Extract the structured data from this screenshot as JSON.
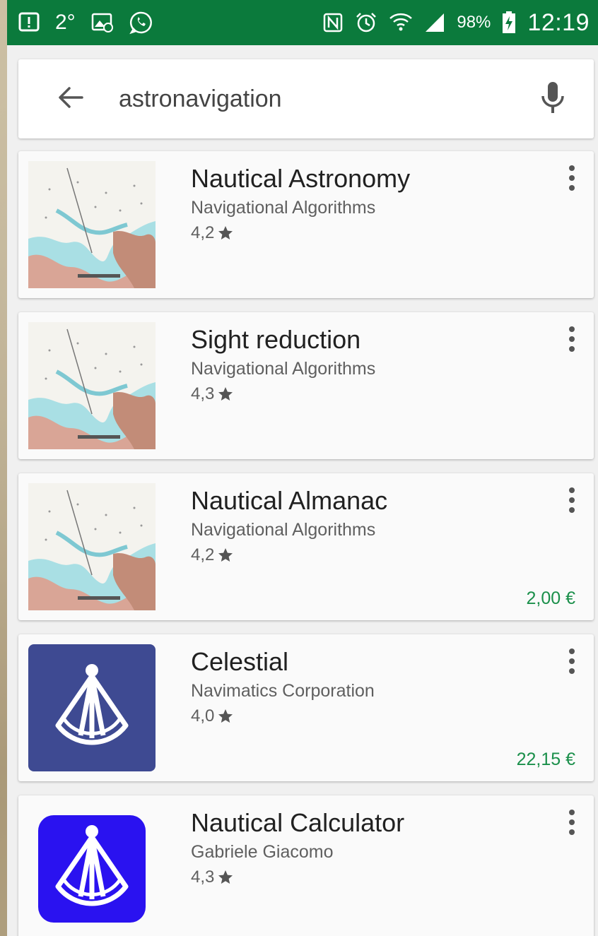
{
  "status_bar": {
    "temperature": "2°",
    "battery": "98%",
    "time": "12:19",
    "icons": [
      "notification-alert-icon",
      "image-notification-icon",
      "whatsapp-icon",
      "nfc-icon",
      "alarm-icon",
      "wifi-icon",
      "signal-icon",
      "battery-charging-icon"
    ]
  },
  "search": {
    "query": "astronavigation",
    "back_icon": "arrow-back-icon",
    "mic_icon": "microphone-icon"
  },
  "colors": {
    "status_bar": "#0b7a3c",
    "price": "#1a8f4a",
    "celestial_icon": "#3e4a92",
    "calculator_icon": "#2a12f0"
  },
  "results": [
    {
      "title": "Nautical Astronomy",
      "developer": "Navigational Algorithms",
      "rating": "4,2",
      "price": "",
      "icon": "nautical-chart-thumbnail"
    },
    {
      "title": "Sight reduction",
      "developer": "Navigational Algorithms",
      "rating": "4,3",
      "price": "",
      "icon": "nautical-chart-thumbnail"
    },
    {
      "title": "Nautical Almanac",
      "developer": "Navigational Algorithms",
      "rating": "4,2",
      "price": "2,00 €",
      "icon": "nautical-chart-thumbnail"
    },
    {
      "title": "Celestial",
      "developer": "Navimatics Corporation",
      "rating": "4,0",
      "price": "22,15 €",
      "icon": "sextant-icon"
    },
    {
      "title": "Nautical Calculator",
      "developer": "Gabriele Giacomo",
      "rating": "4,3",
      "price": "",
      "icon": "sextant-icon"
    }
  ]
}
